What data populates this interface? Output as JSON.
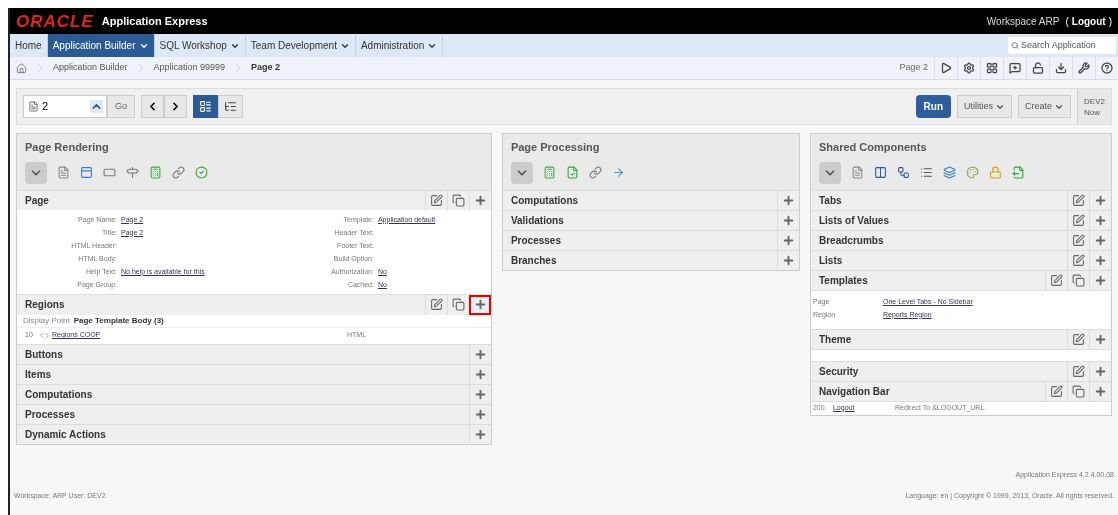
{
  "header": {
    "logo": "ORACLE",
    "product": "Application Express",
    "workspace": "Workspace ARP",
    "logout_open": "(",
    "logout": "Logout",
    "logout_close": ")"
  },
  "nav": {
    "tabs": [
      {
        "label": "Home",
        "selected": false,
        "dropdown": false
      },
      {
        "label": "Application Builder",
        "selected": true,
        "dropdown": true
      },
      {
        "label": "SQL Workshop",
        "selected": false,
        "dropdown": true
      },
      {
        "label": "Team Development",
        "selected": false,
        "dropdown": true
      },
      {
        "label": "Administration",
        "selected": false,
        "dropdown": true
      }
    ],
    "search": {
      "placeholder": "Search Application"
    }
  },
  "breadcrumb": {
    "items": [
      "Application Builder",
      "Application 99999"
    ],
    "current": "Page 2",
    "page_label": "Page 2"
  },
  "toolbar": {
    "page_field": {
      "value": "2"
    },
    "go": "Go",
    "view_modes": [
      {
        "kind": "grid",
        "selected": true
      },
      {
        "kind": "tree",
        "selected": false
      }
    ],
    "run": "Run",
    "utilities": "Utilities",
    "create": "Create",
    "session": [
      "DEV2",
      "Now"
    ]
  },
  "page_rendering": {
    "title": "Page Rendering",
    "page": {
      "title": "Page",
      "actions": [
        {
          "kind": "edit",
          "highlighted": false
        },
        {
          "kind": "copy",
          "highlighted": false
        },
        {
          "kind": "add",
          "highlighted": false
        }
      ],
      "left": [
        {
          "label": "Page Name:",
          "value": "Page 2"
        },
        {
          "label": "Title:",
          "value": "Page 2"
        },
        {
          "label": "HTML Header:"
        },
        {
          "label": "HTML Body:"
        },
        {
          "label": "Help Text:",
          "value": "No help is available for this"
        },
        {
          "label": "Page Group:"
        }
      ],
      "right": [
        {
          "label": "Template:",
          "value": "Application default"
        },
        {
          "label": "Header Text:"
        },
        {
          "label": "Footer Text:"
        },
        {
          "label": "Build Option:"
        },
        {
          "label": "Authorization:",
          "value": "No"
        },
        {
          "label": "Cached:",
          "value": "No"
        }
      ]
    },
    "regions": {
      "title": "Regions",
      "actions": [
        {
          "kind": "edit",
          "highlighted": false
        },
        {
          "kind": "copy",
          "highlighted": false
        },
        {
          "kind": "add",
          "highlighted": true
        }
      ],
      "display_point_label": "Display Point",
      "display_point": "Page Template Body (3)",
      "rows": [
        {
          "seq": "10",
          "name": "Regions COOP",
          "type": "HTML"
        }
      ]
    },
    "sections": [
      {
        "title": "Buttons"
      },
      {
        "title": "Items"
      },
      {
        "title": "Computations"
      },
      {
        "title": "Processes"
      },
      {
        "title": "Dynamic Actions"
      }
    ]
  },
  "page_processing": {
    "title": "Page Processing",
    "sections": [
      {
        "title": "Computations"
      },
      {
        "title": "Validations"
      },
      {
        "title": "Processes"
      },
      {
        "title": "Branches"
      }
    ]
  },
  "shared_components": {
    "title": "Shared Components",
    "sections": [
      {
        "title": "Tabs",
        "actions": [
          {
            "kind": "edit"
          },
          {
            "kind": "add"
          }
        ]
      },
      {
        "title": "Lists of Values",
        "actions": [
          {
            "kind": "edit"
          },
          {
            "kind": "add"
          }
        ]
      },
      {
        "title": "Breadcrumbs",
        "actions": [
          {
            "kind": "edit"
          },
          {
            "kind": "add"
          }
        ]
      },
      {
        "title": "Lists",
        "actions": [
          {
            "kind": "edit"
          },
          {
            "kind": "add"
          }
        ]
      },
      {
        "title": "Templates",
        "actions": [
          {
            "kind": "edit"
          },
          {
            "kind": "copy"
          },
          {
            "kind": "add"
          }
        ],
        "details": [
          {
            "label": "Page",
            "value": "One Level Tabs - No Sidebar"
          },
          {
            "label": "Region",
            "value": "Reports Region"
          }
        ]
      },
      {
        "title": "Theme",
        "actions": [
          {
            "kind": "edit"
          },
          {
            "kind": "add"
          }
        ],
        "blank": true
      },
      {
        "title": "Security",
        "actions": [
          {
            "kind": "edit"
          },
          {
            "kind": "add"
          }
        ]
      },
      {
        "title": "Navigation Bar",
        "actions": [
          {
            "kind": "edit"
          },
          {
            "kind": "copy"
          },
          {
            "kind": "add"
          }
        ],
        "entries": [
          {
            "seq": "200.",
            "name": "Logout",
            "target": "Redirect To &LOGOUT_URL."
          }
        ]
      }
    ]
  },
  "footer": {
    "version": "Application Express 4.2.4.00.08",
    "user": "Workspace: ARP User: DEV2",
    "copyright": "Language: en | Copyright © 1999, 2013, Oracle. All rights reserved."
  }
}
